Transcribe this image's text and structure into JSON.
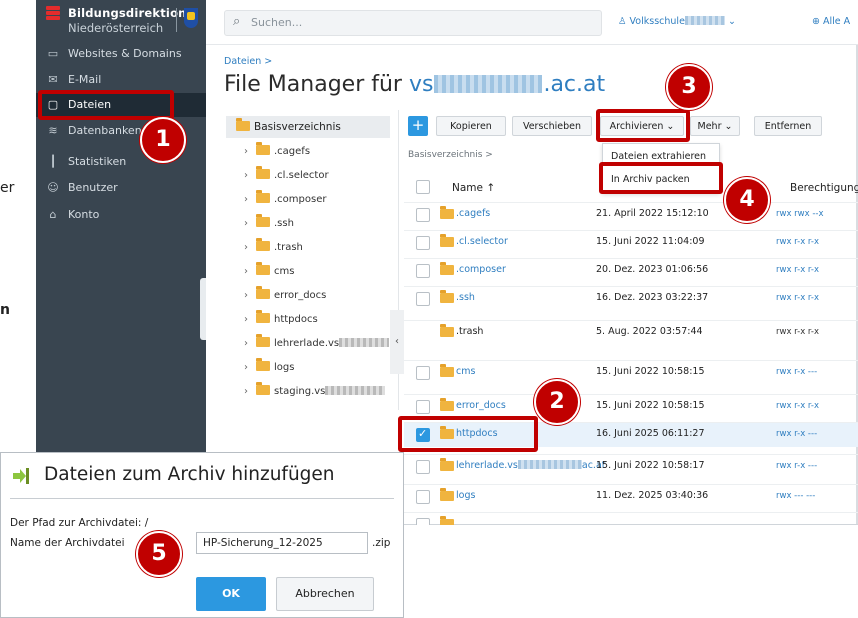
{
  "page": {
    "left_fragments": [
      "er",
      "n"
    ]
  },
  "sidebar": {
    "brand_name": "Bildungsdirektion",
    "brand_sub": "Niederösterreich",
    "items": [
      {
        "label": "Websites & Domains",
        "icon": "monitor-icon"
      },
      {
        "label": "E-Mail",
        "icon": "mail-icon"
      },
      {
        "label": "Dateien",
        "icon": "folder-icon",
        "active": true
      },
      {
        "label": "Datenbanken",
        "icon": "database-icon"
      },
      {
        "label": "Statistiken",
        "icon": "bar-chart-icon"
      },
      {
        "label": "Benutzer",
        "icon": "user-icon"
      },
      {
        "label": "Konto",
        "icon": "account-icon"
      }
    ],
    "collapse_glyph": "‹"
  },
  "header": {
    "search_placeholder": "Suchen...",
    "school": "Volksschule",
    "alle": "Alle A"
  },
  "main": {
    "breadcrumb": "Dateien  >",
    "title_prefix": "File Manager für ",
    "title_domain_start": "vs",
    "title_domain_end": ".ac.at"
  },
  "tree": {
    "root": "Basisverzeichnis",
    "items": [
      ".cagefs",
      ".cl.selector",
      ".composer",
      ".ssh",
      ".trash",
      "cms",
      "error_docs",
      "httpdocs",
      "lehrerlade.vs",
      "logs",
      "staging.vs"
    ],
    "collapse_glyph": "‹"
  },
  "toolbar": {
    "plus": "+",
    "kopieren": "Kopieren",
    "verschieben": "Verschieben",
    "archivieren": "Archivieren ⌄",
    "mehr": "Mehr ⌄",
    "entfernen": "Entfernen"
  },
  "dropdown": {
    "items": [
      "Dateien extrahieren",
      "In Archiv packen"
    ]
  },
  "files": {
    "breadcrumb": "Basisverzeichnis  >",
    "columns": {
      "name": "Name ↑",
      "perm": "Berechtigunger"
    },
    "rows": [
      {
        "name": ".cagefs",
        "date": "21. April 2022 15:12:10",
        "perm": "rwx rwx --x",
        "link": true,
        "perm_link": true
      },
      {
        "name": ".cl.selector",
        "date": "15. Juni 2022 11:04:09",
        "perm": "rwx r-x r-x",
        "link": true,
        "perm_link": true
      },
      {
        "name": ".composer",
        "date": "20. Dez. 2023 01:06:56",
        "perm": "rwx r-x r-x",
        "link": true,
        "perm_link": true
      },
      {
        "name": ".ssh",
        "date": "16. Dez. 2023 03:22:37",
        "perm": "rwx r-x r-x",
        "link": true,
        "perm_link": true
      },
      {
        "name": ".trash",
        "date": "5. Aug. 2022 03:57:44",
        "perm": "rwx r-x r-x",
        "link": false,
        "perm_link": false
      },
      {
        "name": "cms",
        "date": "15. Juni 2022 10:58:15",
        "perm": "rwx r-x ---",
        "link": true,
        "perm_link": true
      },
      {
        "name": "error_docs",
        "date": "15. Juni 2022 10:58:15",
        "perm": "rwx r-x r-x",
        "link": true,
        "perm_link": true
      },
      {
        "name": "httpdocs",
        "date": "16. Juni 2025 06:11:27",
        "perm": "rwx r-x ---",
        "link": true,
        "perm_link": true,
        "selected": true
      },
      {
        "name": "lehrerlade.vs",
        "name_suffix": "ac.at",
        "date": "15. Juni 2022 10:58:17",
        "perm": "rwx r-x ---",
        "link": true,
        "perm_link": true
      },
      {
        "name": "logs",
        "date": "11. Dez. 2025 03:40:36",
        "perm": "rwx --- ---",
        "link": true,
        "perm_link": true
      }
    ]
  },
  "dialog": {
    "title": "Dateien zum Archiv hinzufügen",
    "path_label": "Der Pfad zur Archivdatei: /",
    "name_label": "Name der Archivdatei",
    "name_value": "HP-Sicherung_12-2025",
    "ext": ".zip",
    "ok": "OK",
    "cancel": "Abbrechen"
  },
  "annotations": {
    "steps": [
      "1",
      "2",
      "3",
      "4",
      "5"
    ],
    "color": "#c00000"
  }
}
